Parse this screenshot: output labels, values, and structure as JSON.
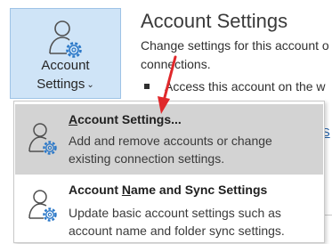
{
  "account_button": {
    "label_line1": "Account",
    "label_line2": "Settings",
    "chevron": "⌄",
    "icon": "account-settings-icon"
  },
  "page": {
    "title": "Account Settings",
    "desc_line1": "Change settings for this account o",
    "desc_line2": "connections.",
    "bullet_text": "Access this account on the w",
    "link_fragment": "S"
  },
  "menu": {
    "items": [
      {
        "title_pre": "",
        "title_ul": "A",
        "title_post": "ccount Settings...",
        "desc": "Add and remove accounts or change existing connection settings.",
        "icon": "account-settings-icon",
        "highlighted": true
      },
      {
        "title_pre": "Account ",
        "title_ul": "N",
        "title_post": "ame and Sync Settings",
        "desc": "Update basic account settings such as account name and folder sync settings.",
        "icon": "account-settings-icon",
        "highlighted": false
      }
    ]
  },
  "colors": {
    "button_bg": "#cfe4f7",
    "menu_highlight": "#d3d3d3",
    "gear_blue": "#2b78c8",
    "arrow_red": "#e0282b"
  }
}
